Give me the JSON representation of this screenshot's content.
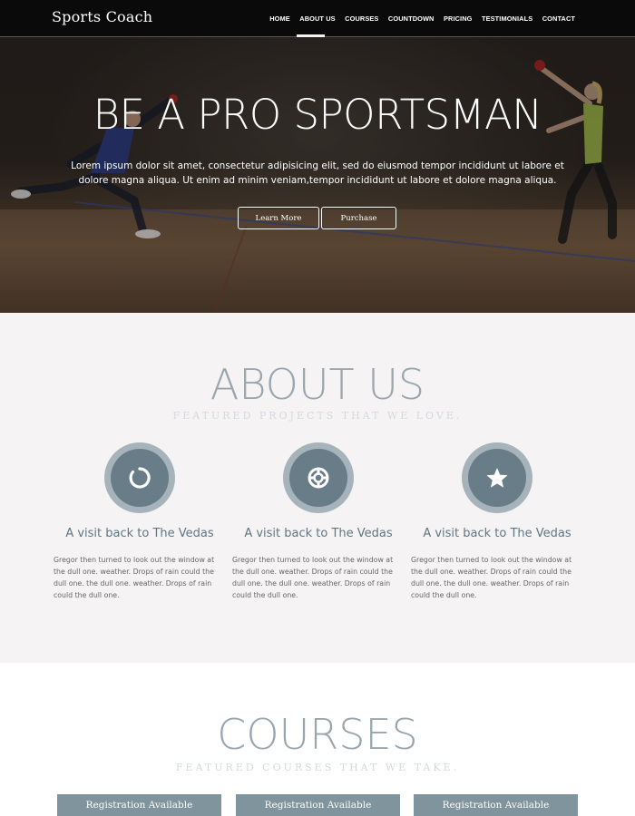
{
  "nav": {
    "brand": "Sports Coach",
    "items": [
      "HOME",
      "ABOUT US",
      "COURSES",
      "COUNTDOWN",
      "PRICING",
      "TESTIMONIALS",
      "CONTACT"
    ],
    "active": "HOME"
  },
  "hero": {
    "title": "BE A PRO SPORTSMAN",
    "text": "Lorem ipsum dolor sit amet, consectetur adipisicing elit, sed do eiusmod tempor incididunt ut labore et dolore magna aliqua. Ut enim ad minim veniam,tempor incididunt ut labore et dolore magna aliqua.",
    "buttons": [
      "Learn More",
      "Purchase"
    ]
  },
  "about": {
    "title": "ABOUT US",
    "subtitle": "FEATURED PROJECTS THAT WE LOVE.",
    "features": [
      {
        "icon": "power-ring-icon",
        "title": "A visit back to The Vedas",
        "text": "Gregor then turned to look out the window at the dull one. weather. Drops of rain could the dull one. the dull one. weather. Drops of rain could the dull one."
      },
      {
        "icon": "lifebuoy-icon",
        "title": "A visit back to The Vedas",
        "text": "Gregor then turned to look out the window at the dull one. weather. Drops of rain could the dull one. the dull one. weather. Drops of rain could the dull one."
      },
      {
        "icon": "star-icon",
        "title": "A visit back to The Vedas",
        "text": "Gregor then turned to look out the window at the dull one. weather. Drops of rain could the dull one. the dull one. weather. Drops of rain could the dull one."
      }
    ]
  },
  "courses": {
    "title": "COURSES",
    "subtitle": "FEATURED COURSES THAT WE TAKE.",
    "badges": [
      "Registration Available",
      "Registration Available",
      "Registration Available"
    ]
  },
  "colors": {
    "nav_bg": "#0b0a0a",
    "accent": "#687d88",
    "circle_outer": "#a7b3ba",
    "badge": "#7f949c",
    "about_bg": "#f5f3f3"
  }
}
